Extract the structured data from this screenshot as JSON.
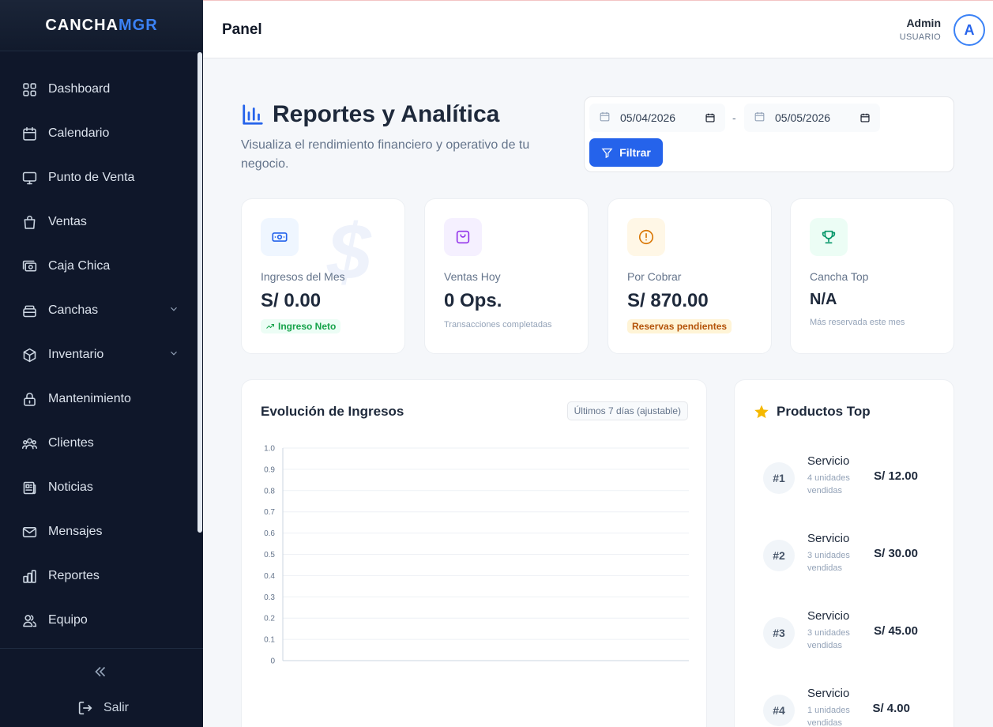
{
  "brand": {
    "part1": "CANCHA",
    "part2": "MGR"
  },
  "sidebar": {
    "items": [
      {
        "label": "Dashboard",
        "icon": "grid-icon"
      },
      {
        "label": "Calendario",
        "icon": "calendar-icon"
      },
      {
        "label": "Punto de Venta",
        "icon": "monitor-icon"
      },
      {
        "label": "Ventas",
        "icon": "shopping-bag-icon"
      },
      {
        "label": "Caja Chica",
        "icon": "cash-icon"
      },
      {
        "label": "Canchas",
        "icon": "layers-icon",
        "expandable": true
      },
      {
        "label": "Inventario",
        "icon": "box-icon",
        "expandable": true
      },
      {
        "label": "Mantenimiento",
        "icon": "lock-icon"
      },
      {
        "label": "Clientes",
        "icon": "users-icon"
      },
      {
        "label": "Noticias",
        "icon": "newspaper-icon"
      },
      {
        "label": "Mensajes",
        "icon": "mail-icon"
      },
      {
        "label": "Reportes",
        "icon": "bar-chart-icon"
      },
      {
        "label": "Equipo",
        "icon": "team-icon"
      }
    ],
    "logout_label": "Salir"
  },
  "header": {
    "title": "Panel",
    "user_name": "Admin",
    "user_role": "USUARIO",
    "avatar_initial": "A"
  },
  "page": {
    "title": "Reportes y Analítica",
    "subtitle": "Visualiza el rendimiento financiero y operativo de tu negocio."
  },
  "filter": {
    "date_from": "05/04/2026",
    "separator": "-",
    "date_to": "05/05/2026",
    "button_label": "Filtrar"
  },
  "stats": [
    {
      "label": "Ingresos del Mes",
      "value": "S/ 0.00",
      "badge": "Ingreso Neto",
      "icon": "money-icon",
      "accent": "#2563eb",
      "bg": "#eff6ff",
      "badge_color": "#16a34a",
      "badge_bg": "#ecfdf5"
    },
    {
      "label": "Ventas Hoy",
      "value": "0 Ops.",
      "foot": "Transacciones completadas",
      "icon": "shopping-bag-icon",
      "accent": "#9333ea",
      "bg": "#f5f0ff"
    },
    {
      "label": "Por Cobrar",
      "value": "S/ 870.00",
      "badge": "Reservas pendientes",
      "icon": "alert-circle-icon",
      "accent": "#d97706",
      "bg": "#fff7e6",
      "badge_color": "#b45309",
      "badge_bg": "#fff4d6"
    },
    {
      "label": "Cancha Top",
      "value": "N/A",
      "foot": "Más reservada este mes",
      "icon": "trophy-icon",
      "accent": "#059669",
      "bg": "#ecfdf5"
    }
  ],
  "watermark_symbol": "$",
  "chart_card": {
    "title": "Evolución de Ingresos",
    "chip": "Últimos 7 días (ajustable)"
  },
  "chart_data": {
    "type": "line",
    "title": "Evolución de Ingresos",
    "x": [],
    "series": [],
    "ylim": [
      0,
      1
    ],
    "yticks": [
      "0",
      "0.1",
      "0.2",
      "0.3",
      "0.4",
      "0.5",
      "0.6",
      "0.7",
      "0.8",
      "0.9",
      "1.0"
    ],
    "grid": true
  },
  "products": {
    "title": "Productos Top",
    "items": [
      {
        "rank": "#1",
        "name": "Servicio",
        "sub": "4 unidades vendidas",
        "price": "S/ 12.00"
      },
      {
        "rank": "#2",
        "name": "Servicio",
        "sub": "3 unidades vendidas",
        "price": "S/ 30.00"
      },
      {
        "rank": "#3",
        "name": "Servicio",
        "sub": "3 unidades vendidas",
        "price": "S/ 45.00"
      },
      {
        "rank": "#4",
        "name": "Servicio",
        "sub": "1 unidades vendidas",
        "price": "S/ 4.00"
      }
    ]
  },
  "colors": {
    "primary": "#2563eb",
    "sidebar_bg": "#0f172a",
    "page_bg": "#f5f7fa"
  }
}
